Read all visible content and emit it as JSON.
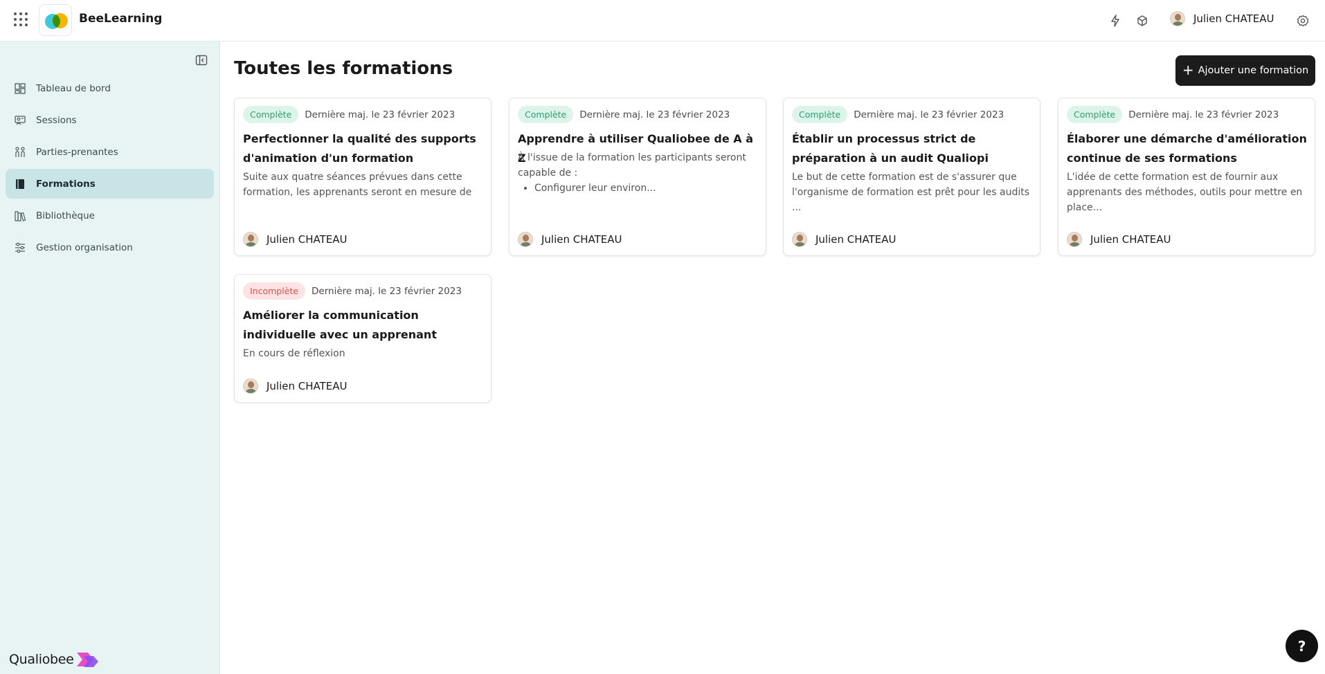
{
  "header": {
    "brand": "BeeLearning",
    "user_name": "Julien CHATEAU",
    "icons": [
      "apps-grid-icon",
      "lightning-icon",
      "cube-icon",
      "settings-icon"
    ]
  },
  "sidebar": {
    "items": [
      {
        "label": "Tableau de bord",
        "icon": "dashboard-icon"
      },
      {
        "label": "Sessions",
        "icon": "sessions-icon"
      },
      {
        "label": "Parties-prenantes",
        "icon": "stakeholders-icon"
      },
      {
        "label": "Formations",
        "icon": "book-icon",
        "active": true
      },
      {
        "label": "Bibliothèque",
        "icon": "library-icon"
      },
      {
        "label": "Gestion organisation",
        "icon": "sliders-icon"
      }
    ],
    "footer_brand": "Qualiobee"
  },
  "main": {
    "title": "Toutes les formations",
    "add_button": "Ajouter une formation",
    "cards": [
      {
        "status": "Complète",
        "date": "Dernière maj. le 23 février 2023",
        "title": "Perfectionner la qualité des supports d'animation d'un formation",
        "description": "Suite aux quatre séances prévues dans cette formation, les apprenants seront en mesure de",
        "author": "Julien CHATEAU"
      },
      {
        "status": "Complète",
        "date": "Dernière maj. le 23 février 2023",
        "title": "Apprendre à utiliser Qualiobee de A à Z",
        "description": "À l'issue de la formation les participants seront capable de :",
        "bullet": "Configurer leur environ...",
        "author": "Julien CHATEAU"
      },
      {
        "status": "Complète",
        "date": "Dernière maj. le 23 février 2023",
        "title": "Établir un processus strict de préparation à un audit Qualiopi",
        "description": "Le but de cette formation est de s'assurer que l'organisme de formation est prêt pour les audits ...",
        "author": "Julien CHATEAU"
      },
      {
        "status": "Complète",
        "date": "Dernière maj. le 23 février 2023",
        "title": "Élaborer une démarche d'amélioration continue de ses formations",
        "description": "L'idée de cette formation est de fournir aux apprenants des méthodes, outils pour mettre en place...",
        "author": "Julien CHATEAU"
      },
      {
        "status": "Incomplète",
        "date": "Dernière maj. le 23 février 2023",
        "title": "Améliorer la communication individuelle avec un apprenant",
        "description": "En cours de réflexion",
        "author": "Julien CHATEAU"
      }
    ]
  },
  "help_label": "?",
  "colors": {
    "sidebar_bg": "#e8f3f4",
    "active_item_bg": "#c9e4e7",
    "complete_badge_bg": "#dcf4ea",
    "complete_badge_text": "#2f9e6e",
    "incomplete_badge_bg": "#fde3e3",
    "incomplete_badge_text": "#d9534f",
    "primary_button": "#1c1c1c"
  }
}
